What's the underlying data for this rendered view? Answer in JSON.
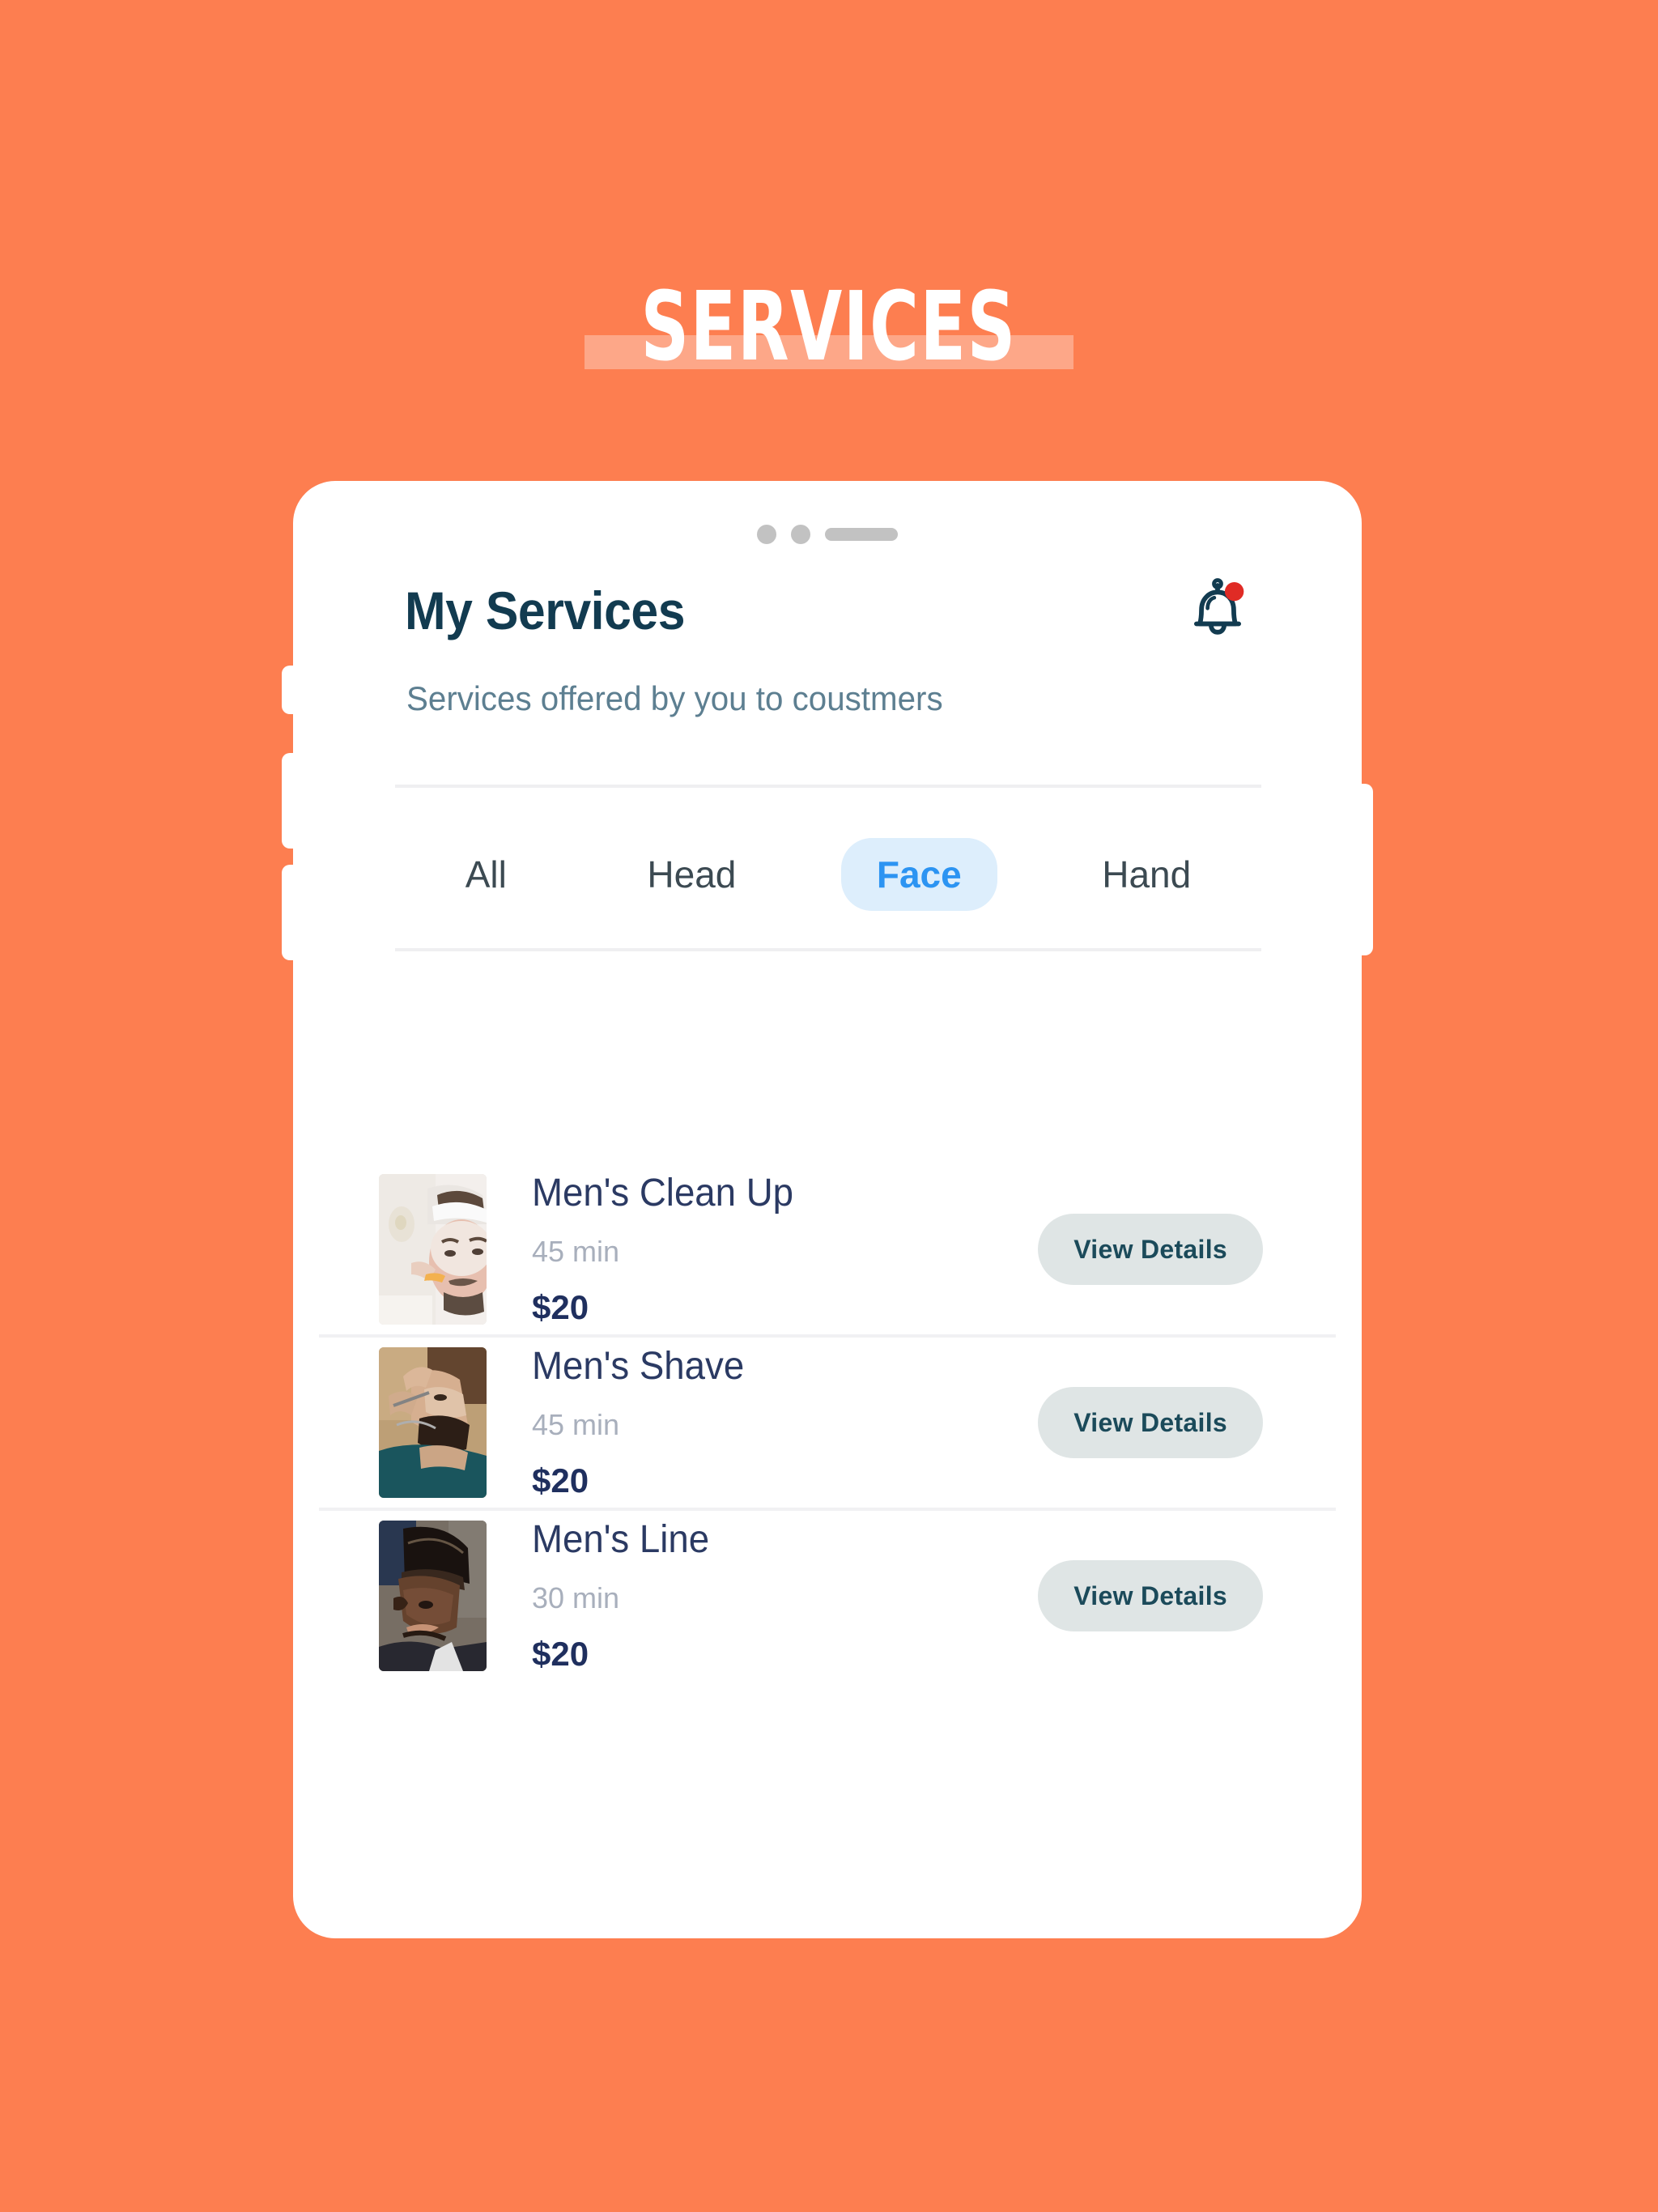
{
  "page": {
    "title": "SERVICES",
    "background_color": "#FD7E50"
  },
  "phone": {
    "header": {
      "app_title": "My Services",
      "subtitle": "Services offered by you to coustmers",
      "notification_icon": "bell-icon",
      "has_notification_badge": true,
      "badge_color": "#E02B25",
      "title_color": "#123B50"
    },
    "tabs": {
      "items": [
        {
          "label": "All",
          "active": false
        },
        {
          "label": "Head",
          "active": false
        },
        {
          "label": "Face",
          "active": true
        },
        {
          "label": "Hand",
          "active": false
        }
      ],
      "active_text_color": "#2C94F2",
      "active_pill_color": "#DDEEFC"
    },
    "services": {
      "action_label": "View Details",
      "items": [
        {
          "name": "Men's Clean Up",
          "duration": "45 min",
          "price": "$20",
          "thumbnail": "mens-clean-up-photo",
          "action": "View Details"
        },
        {
          "name": "Men's Shave",
          "duration": "45 min",
          "price": "$20",
          "thumbnail": "mens-shave-photo",
          "action": "View Details"
        },
        {
          "name": "Men's Line",
          "duration": "30 min",
          "price": "$20",
          "thumbnail": "mens-line-photo",
          "action": "View Details"
        }
      ]
    }
  }
}
